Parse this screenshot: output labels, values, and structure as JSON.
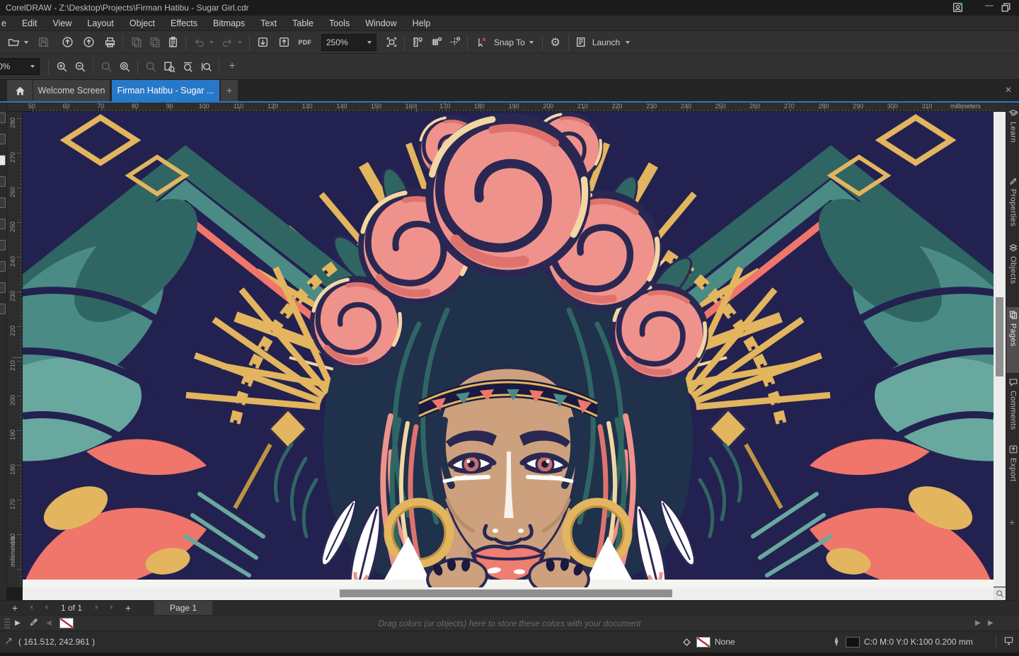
{
  "window": {
    "title": "CorelDRAW - Z:\\Desktop\\Projects\\Firman Hatibu -  Sugar Girl.cdr"
  },
  "menu": {
    "items": [
      "e",
      "Edit",
      "View",
      "Layout",
      "Object",
      "Effects",
      "Bitmaps",
      "Text",
      "Table",
      "Tools",
      "Window",
      "Help"
    ]
  },
  "toolbar": {
    "zoom_level": "250%",
    "pdf": "PDF",
    "snap_to": "Snap To",
    "launch": "Launch"
  },
  "property_bar": {
    "zoom_combo": "0%",
    "add": "+"
  },
  "doc_tabs": {
    "welcome": "Welcome Screen",
    "document": "Firman Hatibu -  Sugar ...",
    "new_tab": "+"
  },
  "rulers": {
    "h_labels": [
      "50",
      "60",
      "70",
      "80",
      "90",
      "100",
      "110",
      "120",
      "130",
      "140",
      "150",
      "160",
      "170",
      "180",
      "190",
      "200",
      "210",
      "220",
      "230",
      "240",
      "250",
      "260",
      "270",
      "280",
      "290",
      "300",
      "310"
    ],
    "v_labels": [
      "280",
      "270",
      "260",
      "250",
      "240",
      "230",
      "220",
      "210",
      "200",
      "190",
      "180",
      "170",
      "160"
    ],
    "unit": "millimeters"
  },
  "dockers": [
    {
      "label": "Learn",
      "active": false
    },
    {
      "label": "Properties",
      "active": false
    },
    {
      "label": "Objects",
      "active": false
    },
    {
      "label": "Pages",
      "active": true
    },
    {
      "label": "Comments",
      "active": false
    },
    {
      "label": "Export",
      "active": false
    }
  ],
  "page_nav": {
    "indicator": "1 of 1",
    "page_tab": "Page 1",
    "add": "+"
  },
  "palette": {
    "hint": "Drag colors (or objects) here to store these colors with your document"
  },
  "status": {
    "coords": "( 161.512, 242.961 )",
    "fill_value": "None",
    "outline_value": "C:0 M:0 Y:0 K:100  0.200 mm"
  },
  "artwork": {
    "description": "Sugar Girl — symmetric pop-art portrait of a woman with a rose crown, golden sunburst rays, feather earrings, gold hoops and teal butterfly-wing mandala on a navy background",
    "palette": {
      "navy": "#232150",
      "navyDeep": "#1a1940",
      "outline": "#2a2852",
      "teal": "#4a8b85",
      "tealDark": "#2f6663",
      "tealLight": "#69a89f",
      "coral": "#f0756a",
      "pink": "#f0928c",
      "pinkDark": "#de736d",
      "cream": "#f2d6a4",
      "gold": "#e2b55e",
      "goldDark": "#be9440",
      "skin": "#cda17d",
      "skinShadow": "#b68c69",
      "hair": "#20314b",
      "lips": "#ee7e72",
      "white": "#ffffff"
    }
  },
  "ui": {
    "accent": "#2878c8"
  }
}
